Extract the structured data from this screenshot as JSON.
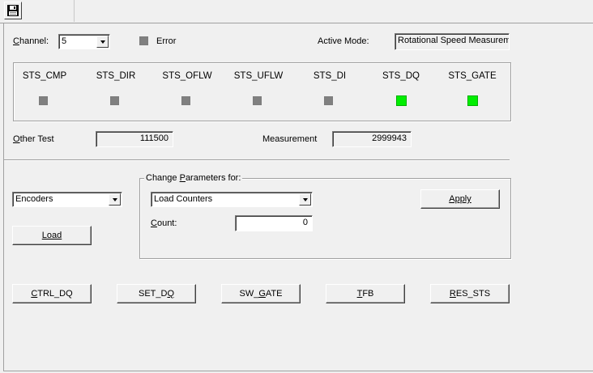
{
  "toolbar": {
    "save_icon": "floppy-disk-icon"
  },
  "status": {
    "channel_label": "Channel:",
    "channel_value": "5",
    "error_label": "Error",
    "active_mode_label": "Active Mode:",
    "active_mode_value": "Rotational Speed Measurement",
    "flags": [
      {
        "name": "STS_CMP",
        "state": "off",
        "color": "#808080"
      },
      {
        "name": "STS_DIR",
        "state": "off",
        "color": "#808080"
      },
      {
        "name": "STS_OFLW",
        "state": "off",
        "color": "#808080"
      },
      {
        "name": "STS_UFLW",
        "state": "off",
        "color": "#808080"
      },
      {
        "name": "STS_DI",
        "state": "off",
        "color": "#808080"
      },
      {
        "name": "STS_DQ",
        "state": "on",
        "color": "#00ee00"
      },
      {
        "name": "STS_GATE",
        "state": "on",
        "color": "#00ee00"
      }
    ],
    "other_test_label": "Other Test",
    "other_test_value": "111500",
    "measurement_label": "Measurement",
    "measurement_value": "2999943"
  },
  "params": {
    "module_value": "Encoders",
    "load_button": "Load",
    "group_title": "Change Parameters for:",
    "param_value": "Load Counters",
    "count_label": "Count:",
    "count_value": "0",
    "apply_button": "Apply"
  },
  "actions": {
    "ctrl_dq": "CTRL_DQ",
    "set_dq": "SET_DQ",
    "sw_gate": "SW_GATE",
    "tfb": "TFB",
    "res_sts": "RES_STS"
  },
  "colors": {
    "led_off": "#808080",
    "led_on": "#00ee00",
    "background": "#f0f0f0"
  }
}
